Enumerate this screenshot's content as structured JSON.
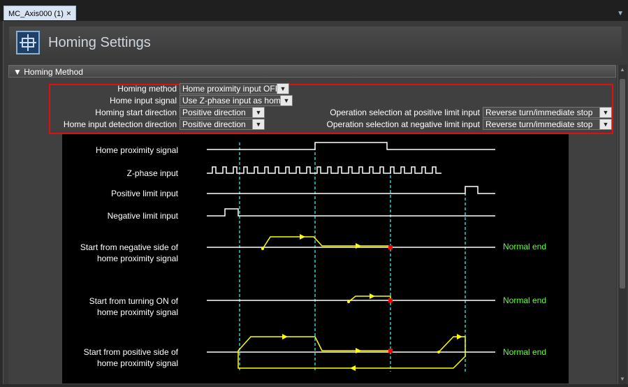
{
  "tab": {
    "label": "MC_Axis000 (1)",
    "close_glyph": "×"
  },
  "header": {
    "title": "Homing Settings",
    "icon": "homing-crosshair-icon"
  },
  "section": {
    "title": "Homing Method",
    "expand_glyph": "▼"
  },
  "settings": {
    "homing_method": {
      "label": "Homing method",
      "value": "Home proximity input OFF"
    },
    "home_input_signal": {
      "label": "Home input signal",
      "value": "Use Z-phase input as home"
    },
    "homing_start_direction": {
      "label": "Homing start direction",
      "value": "Positive direction"
    },
    "home_input_detection_direction": {
      "label": "Home input detection direction",
      "value": "Positive direction"
    },
    "positive_limit_operation": {
      "label": "Operation selection at positive limit input",
      "value": "Reverse turn/immediate stop"
    },
    "negative_limit_operation": {
      "label": "Operation selection at negative limit input",
      "value": "Reverse turn/immediate stop"
    }
  },
  "diagram": {
    "signals": {
      "home_proximity": "Home proximity signal",
      "z_phase": "Z-phase input",
      "positive_limit": "Positive limit input",
      "negative_limit": "Negative limit input"
    },
    "cases": [
      {
        "line1": "Start from negative side of",
        "line2": "home proximity signal",
        "result": "Normal end"
      },
      {
        "line1": "Start from turning ON of",
        "line2": "home proximity signal",
        "result": "Normal end"
      },
      {
        "line1": "Start from positive side of",
        "line2": "home proximity signal",
        "result": "Normal end"
      }
    ],
    "colors": {
      "signal": "#ffffff",
      "path": "#ffff00",
      "guide": "#33cccc",
      "stop": "#ff0000",
      "normal_end": "#66ff33"
    }
  }
}
